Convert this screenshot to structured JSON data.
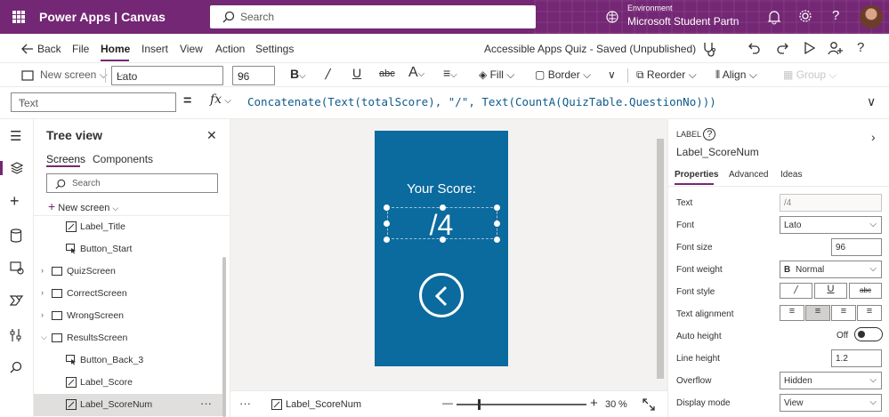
{
  "topbar": {
    "app_name": "Power Apps  |  Canvas",
    "search_placeholder": "Search",
    "env_label": "Environment",
    "env_name": "Microsoft Student Partn"
  },
  "menu": {
    "back": "Back",
    "items": [
      "File",
      "Home",
      "Insert",
      "View",
      "Action",
      "Settings"
    ],
    "active": "Home",
    "save_status": "Accessible Apps Quiz - Saved (Unpublished)"
  },
  "toolbar": {
    "new_screen": "New screen",
    "font": "Lato",
    "font_size": "96",
    "fill": "Fill",
    "border": "Border",
    "reorder": "Reorder",
    "align": "Align",
    "group": "Group"
  },
  "formula": {
    "property": "Text",
    "eq": "=",
    "fx": "fx",
    "expression": "Concatenate(Text(totalScore), \"/\", Text(CountA(QuizTable.QuestionNo)))"
  },
  "tree": {
    "title": "Tree view",
    "tabs": [
      "Screens",
      "Components"
    ],
    "search_placeholder": "Search",
    "new_screen": "New screen",
    "items": [
      {
        "label": "Label_Title",
        "type": "label",
        "indent": 2
      },
      {
        "label": "Button_Start",
        "type": "button",
        "indent": 2
      },
      {
        "label": "QuizScreen",
        "type": "screen",
        "indent": 1,
        "collapsed": true
      },
      {
        "label": "CorrectScreen",
        "type": "screen",
        "indent": 1,
        "collapsed": true
      },
      {
        "label": "WrongScreen",
        "type": "screen",
        "indent": 1,
        "collapsed": true
      },
      {
        "label": "ResultsScreen",
        "type": "screen",
        "indent": 1,
        "collapsed": false
      },
      {
        "label": "Button_Back_3",
        "type": "button",
        "indent": 2
      },
      {
        "label": "Label_Score",
        "type": "label",
        "indent": 2
      },
      {
        "label": "Label_ScoreNum",
        "type": "label",
        "indent": 2,
        "selected": true
      }
    ],
    "more": "···"
  },
  "canvas": {
    "your_score": "Your Score:",
    "score_text": "/4",
    "accent": "#0b6a9e"
  },
  "status": {
    "more": "···",
    "selected": "Label_ScoreNum",
    "minus": "—",
    "plus": "+",
    "zoom": "30",
    "zoom_unit": "%",
    "zoom_level": 0.3
  },
  "props": {
    "type_label": "LABEL",
    "control_name": "Label_ScoreNum",
    "tabs": [
      "Properties",
      "Advanced",
      "Ideas"
    ],
    "rows": {
      "text": {
        "label": "Text",
        "value": "/4"
      },
      "font": {
        "label": "Font",
        "value": "Lato"
      },
      "font_size": {
        "label": "Font size",
        "value": "96"
      },
      "font_weight": {
        "label": "Font weight",
        "value": "Normal",
        "prefix": "B"
      },
      "font_style": {
        "label": "Font style"
      },
      "text_alignment": {
        "label": "Text alignment"
      },
      "auto_height": {
        "label": "Auto height",
        "value": "Off"
      },
      "line_height": {
        "label": "Line height",
        "value": "1.2"
      },
      "overflow": {
        "label": "Overflow",
        "value": "Hidden"
      },
      "display_mode": {
        "label": "Display mode",
        "value": "View"
      }
    }
  }
}
